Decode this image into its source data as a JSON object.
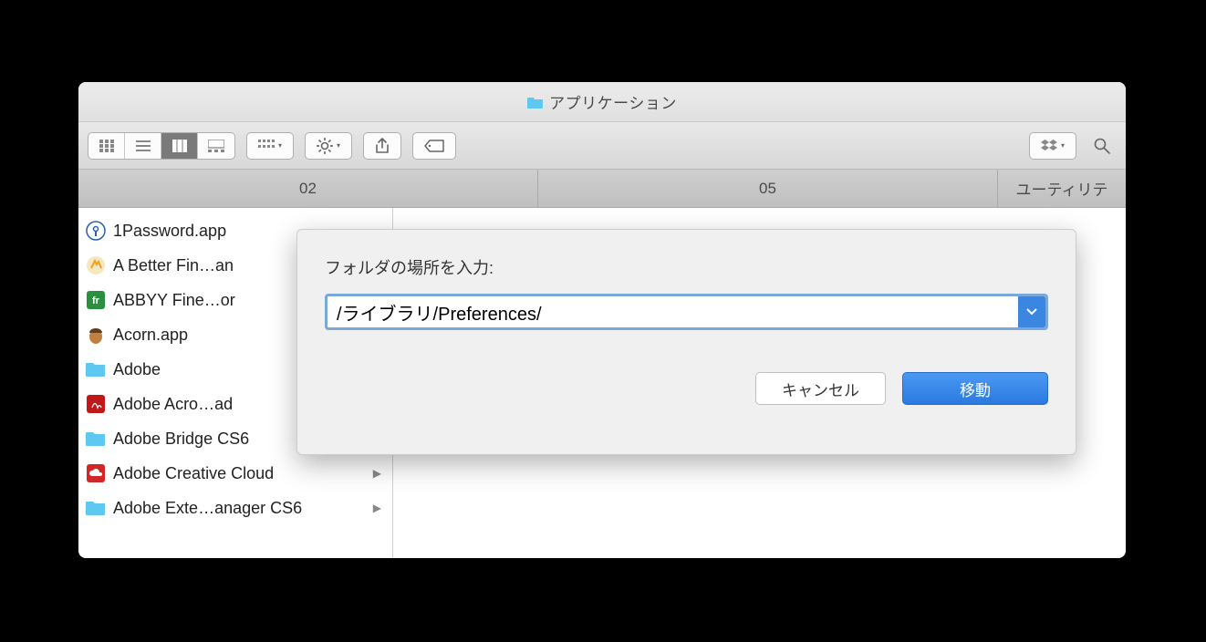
{
  "window": {
    "title": "アプリケーション"
  },
  "tabs": [
    "02",
    "05",
    "ユーティリテ"
  ],
  "files": [
    {
      "name": "1Password.app",
      "icon": "app-1password",
      "folder": false,
      "disclosure": false
    },
    {
      "name": "A Better Fin…an",
      "icon": "app-abetter",
      "folder": false,
      "disclosure": false
    },
    {
      "name": "ABBYY Fine…or",
      "icon": "app-abbyy",
      "folder": false,
      "disclosure": false
    },
    {
      "name": "Acorn.app",
      "icon": "app-acorn",
      "folder": false,
      "disclosure": false
    },
    {
      "name": "Adobe",
      "icon": "folder",
      "folder": true,
      "disclosure": false
    },
    {
      "name": "Adobe Acro…ad",
      "icon": "app-acrobat",
      "folder": false,
      "disclosure": false
    },
    {
      "name": "Adobe Bridge CS6",
      "icon": "folder",
      "folder": true,
      "disclosure": true
    },
    {
      "name": "Adobe Creative Cloud",
      "icon": "app-cc",
      "folder": false,
      "disclosure": true
    },
    {
      "name": "Adobe Exte…anager CS6",
      "icon": "folder",
      "folder": true,
      "disclosure": true
    }
  ],
  "dialog": {
    "label": "フォルダの場所を入力:",
    "value": "/ライブラリ/Preferences/",
    "cancel": "キャンセル",
    "confirm": "移動"
  }
}
